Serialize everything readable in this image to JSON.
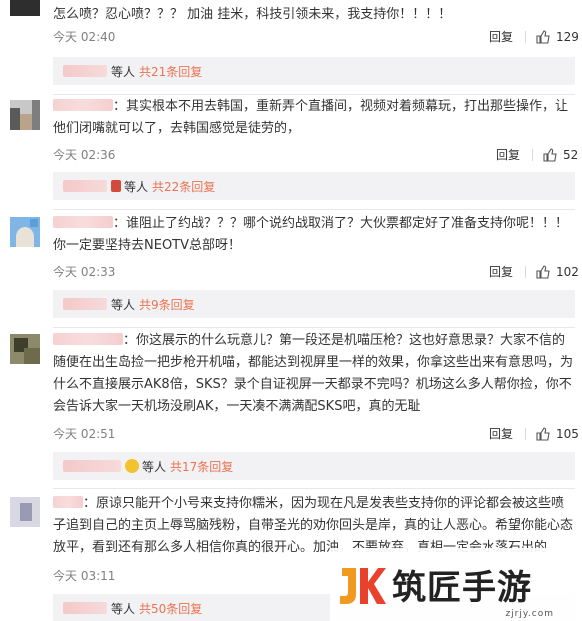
{
  "comments": [
    {
      "text": "怎么喷？忍心喷？？？      加油 挂米，科技引领未来，我支持你！！！！",
      "time": "今天 02:40",
      "reply_label": "回复",
      "likes": "129",
      "replies": {
        "people_label": "等人",
        "count_label": "共21条回复"
      }
    },
    {
      "sep": "：",
      "text": "其实根本不用去韩国，重新弄个直播间，视频对着频幕玩，打出那些操作，让他们闭嘴就可以了，去韩国感觉是徒劳的，",
      "time": "今天 02:36",
      "reply_label": "回复",
      "likes": "52",
      "replies": {
        "people_label": "等人",
        "count_label": "共22条回复"
      }
    },
    {
      "sep": "：",
      "text": "谁阻止了约战？？？哪个说约战取消了？大伙票都定好了准备支持你呢！！！你一定要坚持去NEOTV总部呀！",
      "time": "今天 02:33",
      "reply_label": "回复",
      "likes": "102",
      "replies": {
        "people_label": "等人",
        "count_label": "共9条回复"
      }
    },
    {
      "sep": "：",
      "text": "你这展示的什么玩意儿？第一段还是机喵压枪？这也好意思录？大家不信的随便在出生岛捡一把步枪开机喵，都能达到视屏里一样的效果，你拿这些出来有意思吗，为什么不直接展示AK8倍，SKS？录个自证视屏一天都录不完吗？机场这么多人帮你捡，你不会告诉大家一天机场没刷AK，一天凑不满满配SKS吧，真的无耻",
      "time": "今天 02:51",
      "reply_label": "回复",
      "likes": "105",
      "replies": {
        "people_label": "等人",
        "count_label": "共17条回复"
      }
    },
    {
      "sep": "：",
      "text": "原谅只能开个小号来支持你糯米，因为现在凡是发表些支持你的评论都会被这些喷子追到自己的主页上辱骂脑残粉，自带圣光的劝你回头是岸，真的让人恶心。希望你能心态放平，看到还有那么多人相信你真的很开心。加油，不要放弃，真相一定会水落石出的",
      "time": "今天 03:11",
      "reply_label": "回复",
      "likes": "",
      "replies": {
        "people_label": "等人",
        "count_label": "共50条回复"
      }
    }
  ],
  "watermark": {
    "logo_text": "JK",
    "title": "筑匠手游",
    "url": "zjrjy.com"
  },
  "colors": {
    "accent": "#eb7350",
    "reply_bg": "#f2f2f5",
    "meta": "#808080"
  }
}
